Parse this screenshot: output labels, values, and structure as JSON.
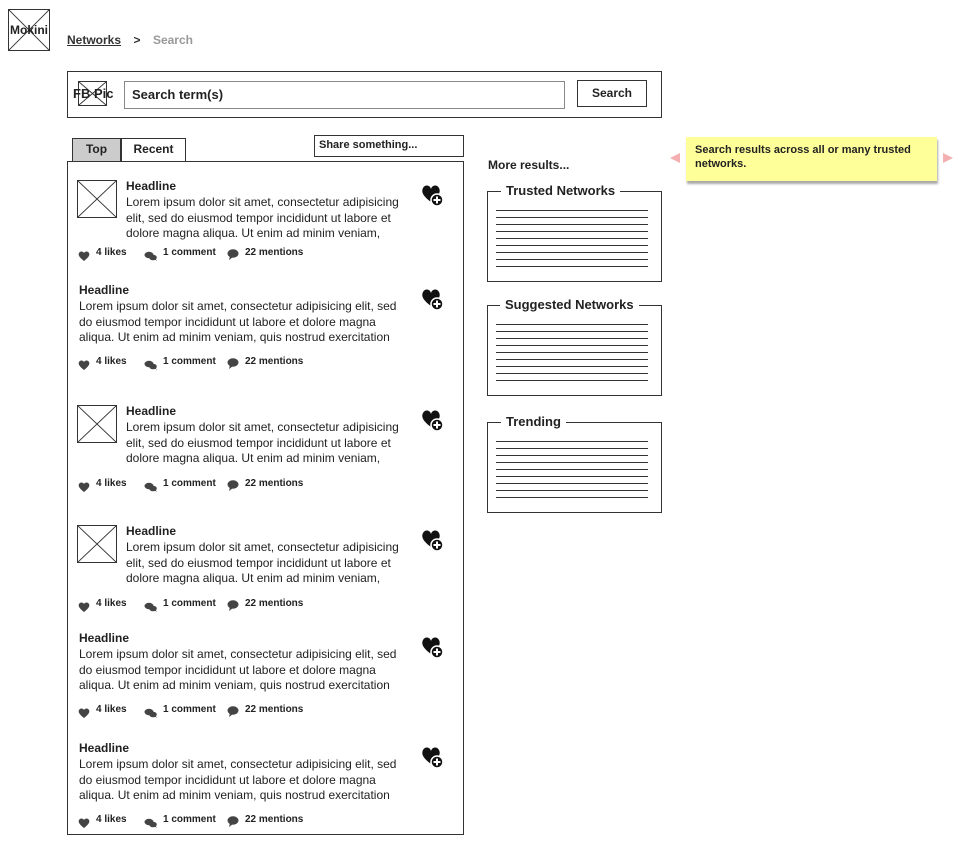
{
  "logo": {
    "label": "Mokini"
  },
  "breadcrumb": {
    "link": "Networks",
    "separator": ">",
    "current": "Search"
  },
  "search": {
    "pic_label": "FB Pic",
    "value": "Search term(s)",
    "button_label": "Search"
  },
  "tabs": [
    {
      "label": "Top",
      "active": true
    },
    {
      "label": "Recent",
      "active": false
    }
  ],
  "share": {
    "placeholder": "Share something..."
  },
  "feed": {
    "posts": [
      {
        "has_image": true,
        "headline": "Headline",
        "text": "Lorem ipsum dolor sit amet, consectetur adipisicing elit, sed do eiusmod tempor incididunt ut labore et dolore magna aliqua. Ut enim ad minim veniam,",
        "likes": "4 likes",
        "comments": "1 comment",
        "mentions": "22 mentions"
      },
      {
        "has_image": false,
        "headline": "Headline",
        "text": "Lorem ipsum dolor sit amet, consectetur adipisicing elit, sed do eiusmod tempor incididunt ut labore et dolore magna aliqua. Ut enim ad minim veniam, quis nostrud exercitation",
        "likes": "4 likes",
        "comments": "1 comment",
        "mentions": "22 mentions"
      },
      {
        "has_image": true,
        "headline": "Headline",
        "text": "Lorem ipsum dolor sit amet, consectetur adipisicing elit, sed do eiusmod tempor incididunt ut labore et dolore magna aliqua. Ut enim ad minim veniam,",
        "likes": "4 likes",
        "comments": "1 comment",
        "mentions": "22 mentions"
      },
      {
        "has_image": true,
        "headline": "Headline",
        "text": "Lorem ipsum dolor sit amet, consectetur adipisicing elit, sed do eiusmod tempor incididunt ut labore et dolore magna aliqua. Ut enim ad minim veniam,",
        "likes": "4 likes",
        "comments": "1 comment",
        "mentions": "22 mentions"
      },
      {
        "has_image": false,
        "headline": "Headline",
        "text": "Lorem ipsum dolor sit amet, consectetur adipisicing elit, sed do eiusmod tempor incididunt ut labore et dolore magna aliqua. Ut enim ad minim veniam, quis nostrud exercitation",
        "likes": "4 likes",
        "comments": "1 comment",
        "mentions": "22 mentions"
      },
      {
        "has_image": false,
        "headline": "Headline",
        "text": "Lorem ipsum dolor sit amet, consectetur adipisicing elit, sed do eiusmod tempor incididunt ut labore et dolore magna aliqua. Ut enim ad minim veniam, quis nostrud exercitation",
        "likes": "4 likes",
        "comments": "1 comment",
        "mentions": "22 mentions"
      }
    ]
  },
  "sidebar": {
    "more_results": "More results...",
    "groups": [
      {
        "title": "Trusted Networks"
      },
      {
        "title": "Suggested Networks"
      },
      {
        "title": "Trending"
      }
    ]
  },
  "note": {
    "text": "Search results across all or many trusted networks.",
    "color": "#ffff99"
  }
}
